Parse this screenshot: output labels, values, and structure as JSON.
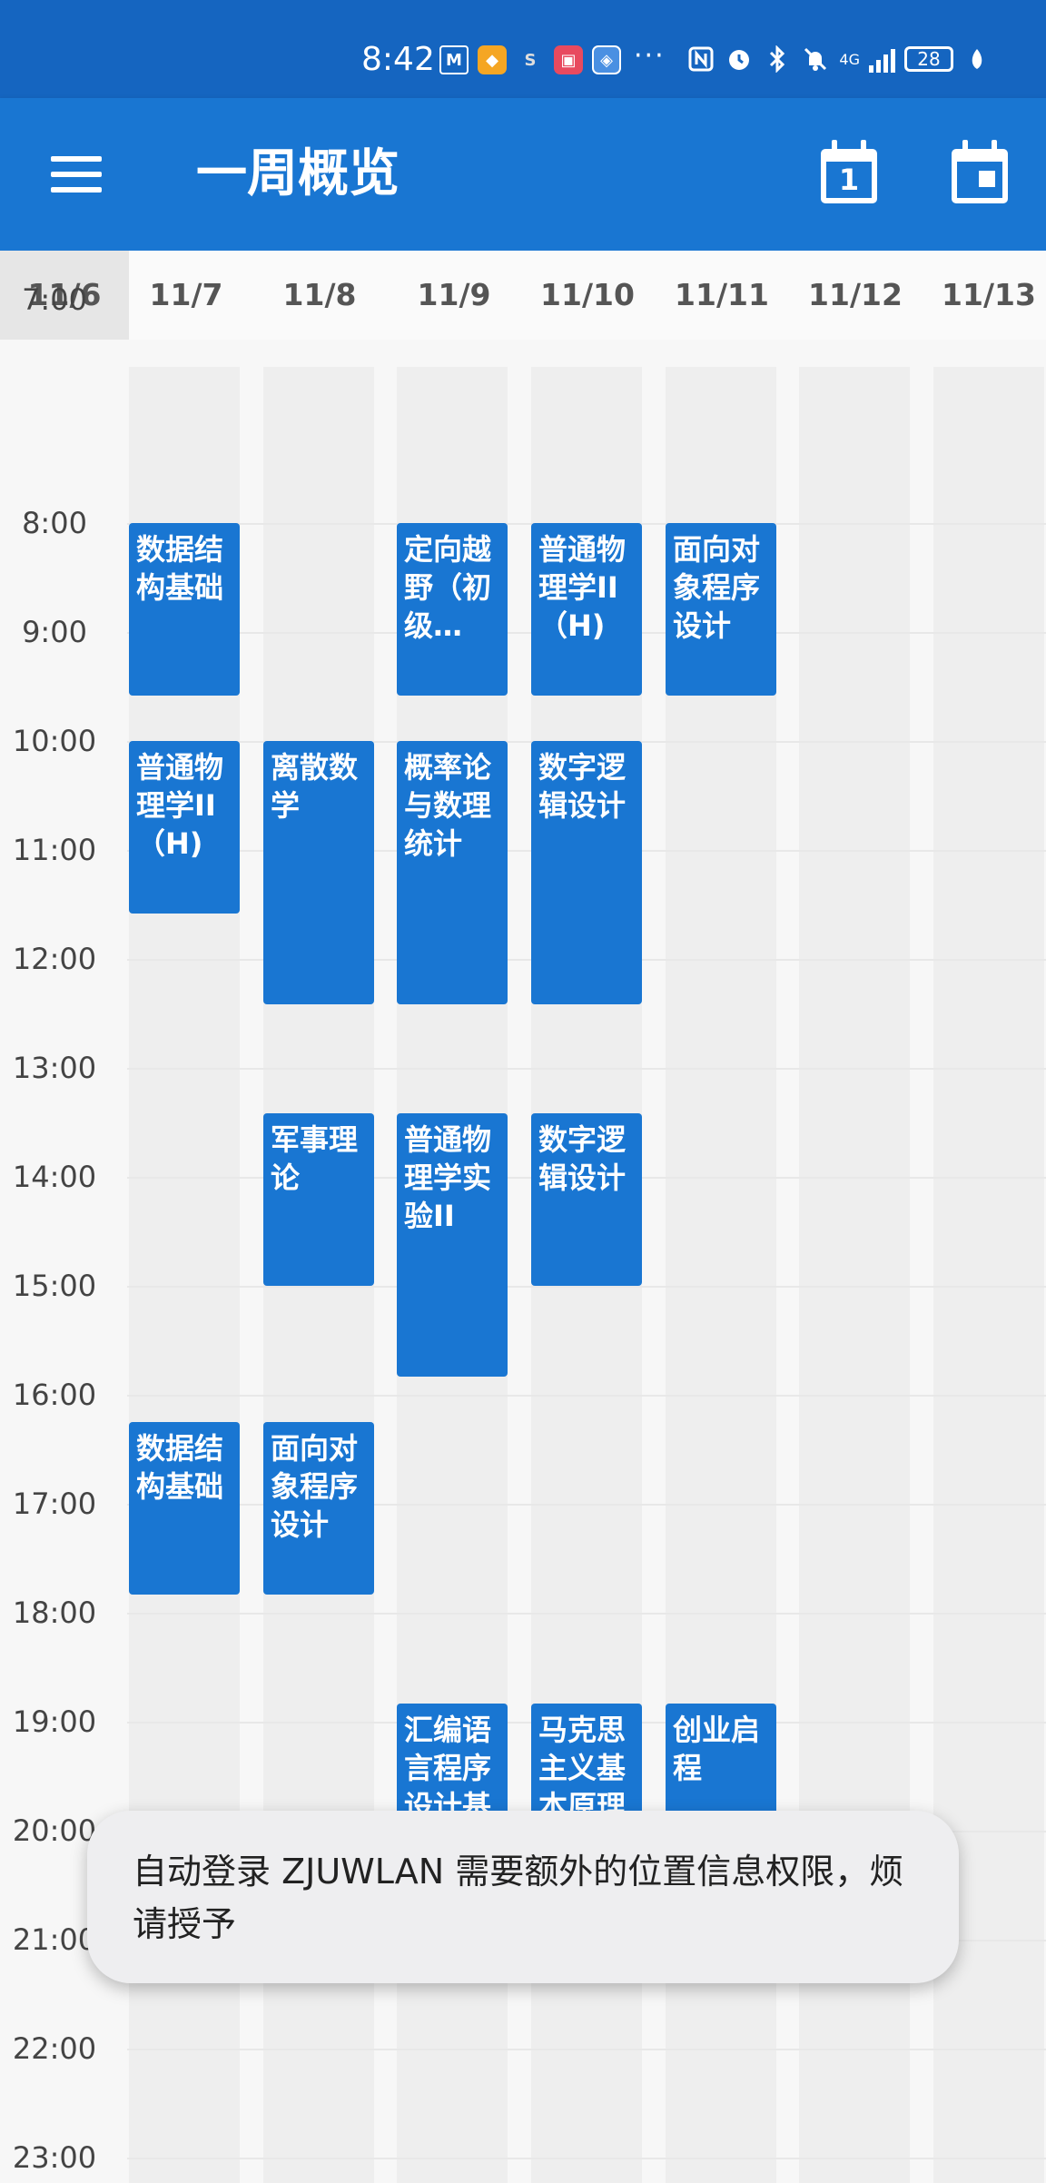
{
  "status_bar": {
    "time": "8:42",
    "app_icons": [
      "M",
      "◆",
      "S",
      "▣",
      "◈"
    ],
    "overflow": "···",
    "network": "4G",
    "battery": "28"
  },
  "app_bar": {
    "title": "一周概览",
    "today_button_number": "1",
    "icons": [
      "menu-icon",
      "calendar-today-icon",
      "calendar-event-icon"
    ]
  },
  "dates": [
    "11/6",
    "11/7",
    "11/8",
    "11/9",
    "11/10",
    "11/11",
    "11/12",
    "11/13"
  ],
  "hours": [
    "7:00",
    "8:00",
    "9:00",
    "10:00",
    "11:00",
    "12:00",
    "13:00",
    "14:00",
    "15:00",
    "16:00",
    "17:00",
    "18:00",
    "19:00",
    "20:00",
    "21:00",
    "22:00",
    "23:00"
  ],
  "events": [
    {
      "day": 1,
      "start": "8:00",
      "end": "9:35",
      "title": "数据结构基础"
    },
    {
      "day": 1,
      "start": "10:00",
      "end": "11:35",
      "title": "普通物理学II（H)"
    },
    {
      "day": 1,
      "start": "16:15",
      "end": "17:50",
      "title": "数据结构基础"
    },
    {
      "day": 2,
      "start": "10:00",
      "end": "12:25",
      "title": "离散数学"
    },
    {
      "day": 2,
      "start": "13:25",
      "end": "15:00",
      "title": "军事理论"
    },
    {
      "day": 2,
      "start": "16:15",
      "end": "17:50",
      "title": "面向对象程序设计"
    },
    {
      "day": 3,
      "start": "8:00",
      "end": "9:35",
      "title": "定向越野（初级…"
    },
    {
      "day": 3,
      "start": "10:00",
      "end": "12:25",
      "title": "概率论与数理统计"
    },
    {
      "day": 3,
      "start": "13:25",
      "end": "15:50",
      "title": "普通物理学实验II"
    },
    {
      "day": 3,
      "start": "18:50",
      "end": "20:45",
      "title": "汇编语言程序设计基础"
    },
    {
      "day": 4,
      "start": "8:00",
      "end": "9:35",
      "title": "普通物理学II（H)"
    },
    {
      "day": 4,
      "start": "10:00",
      "end": "12:25",
      "title": "数字逻辑设计"
    },
    {
      "day": 4,
      "start": "13:25",
      "end": "15:00",
      "title": "数字逻辑设计"
    },
    {
      "day": 4,
      "start": "18:50",
      "end": "20:45",
      "title": "马克思主义基本原理（H)"
    },
    {
      "day": 5,
      "start": "8:00",
      "end": "9:35",
      "title": "面向对象程序设计"
    },
    {
      "day": 5,
      "start": "18:50",
      "end": "20:45",
      "title": "创业启程"
    }
  ],
  "toast": {
    "message": "自动登录 ZJUWLAN 需要额外的位置信息权限，烦请授予"
  }
}
